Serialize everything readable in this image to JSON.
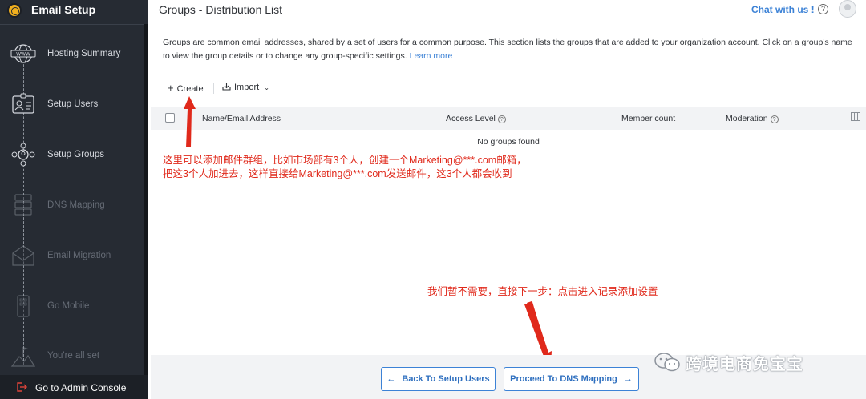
{
  "sidebar": {
    "title": "Email Setup",
    "items": [
      {
        "label": "Hosting Summary",
        "icon": "www-globe-icon",
        "state": "done"
      },
      {
        "label": "Setup Users",
        "icon": "user-card-icon",
        "state": "done"
      },
      {
        "label": "Setup Groups",
        "icon": "group-icon",
        "state": "current"
      },
      {
        "label": "DNS Mapping",
        "icon": "server-icon",
        "state": "pending"
      },
      {
        "label": "Email Migration",
        "icon": "envelope-icon",
        "state": "pending"
      },
      {
        "label": "Go Mobile",
        "icon": "mobile-icon",
        "state": "pending"
      },
      {
        "label": "You're all set",
        "icon": "flag-icon",
        "state": "pending"
      }
    ],
    "footer_label": "Go to Admin Console"
  },
  "header": {
    "title": "Groups - Distribution List",
    "chat_label": "Chat with us !",
    "help_glyph": "?"
  },
  "description": {
    "text": "Groups are common email addresses, shared by a set of users for a common purpose. This section lists the groups that are added to your organization account. Click on a group's name to view the group details or to change any group-specific settings.",
    "link": "Learn more"
  },
  "toolbar": {
    "create_label": "Create",
    "import_label": "Import"
  },
  "table": {
    "columns": [
      "Name/Email Address",
      "Access Level",
      "Member count",
      "Moderation"
    ],
    "empty_text": "No groups found"
  },
  "annotations": {
    "top_line1": "这里可以添加邮件群组，比如市场部有3个人，创建一个Marketing@***.com邮箱，",
    "top_line2": "把这3个人加进去，这样直接给Marketing@***.com发送邮件，这3个人都会收到",
    "bottom": "我们暂不需要，直接下一步：点击进入记录添加设置"
  },
  "footer": {
    "back_label": "Back To Setup Users",
    "next_label": "Proceed To DNS Mapping"
  },
  "watermark": "跨境电商免宝宝",
  "colors": {
    "sidebar_bg": "#262b33",
    "accent": "#3c82d6",
    "annotation": "#e0291b"
  }
}
